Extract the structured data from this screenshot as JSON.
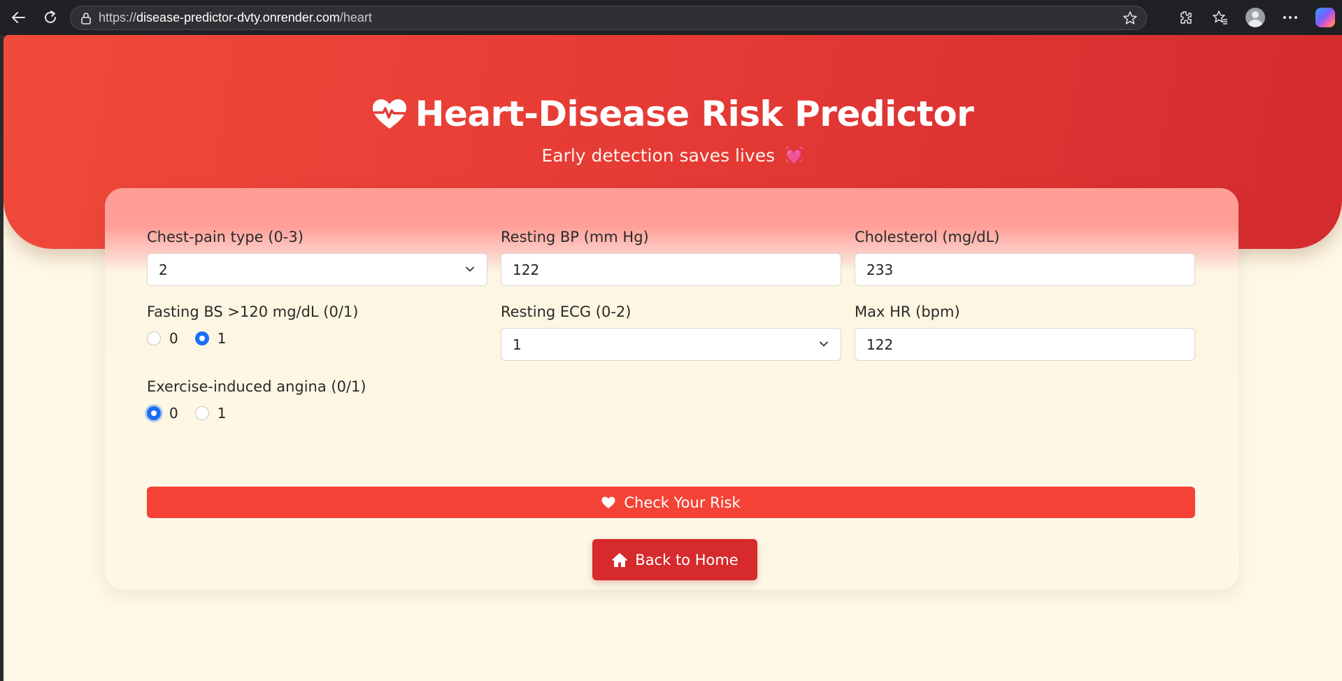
{
  "browser": {
    "url_scheme": "https://",
    "url_host": "disease-predictor-dvty.onrender.com",
    "url_path": "/heart"
  },
  "hero": {
    "title": "Heart-Disease Risk Predictor",
    "subtitle": "Early detection saves lives",
    "subtitle_emoji": "💓"
  },
  "form": {
    "chest_pain": {
      "label": "Chest-pain type (0-3)",
      "value": "2"
    },
    "resting_bp": {
      "label": "Resting BP (mm Hg)",
      "value": "122"
    },
    "cholesterol": {
      "label": "Cholesterol (mg/dL)",
      "value": "233"
    },
    "fasting_bs": {
      "label": "Fasting BS >120 mg/dL (0/1)",
      "option_0": "0",
      "option_1": "1",
      "selected": "1"
    },
    "resting_ecg": {
      "label": "Resting ECG (0-2)",
      "value": "1"
    },
    "max_hr": {
      "label": "Max HR (bpm)",
      "value": "122"
    },
    "exercise_angina": {
      "label": "Exercise-induced angina (0/1)",
      "option_0": "0",
      "option_1": "1",
      "selected": "0"
    }
  },
  "buttons": {
    "check_risk": "Check Your Risk",
    "back_home": "Back to Home"
  },
  "colors": {
    "hero_red": "#e53a35",
    "button_red": "#f44336",
    "home_red": "#d62a2c",
    "page_bg": "#fdf9e6",
    "radio_blue": "#1a6ef5"
  },
  "icons": [
    "back-arrow-icon",
    "reload-icon",
    "lock-icon",
    "star-icon",
    "extensions-icon",
    "favorites-icon",
    "profile-icon",
    "more-icon",
    "copilot-icon",
    "heart-pulse-icon",
    "heart-icon",
    "home-icon",
    "chevron-down-icon"
  ]
}
